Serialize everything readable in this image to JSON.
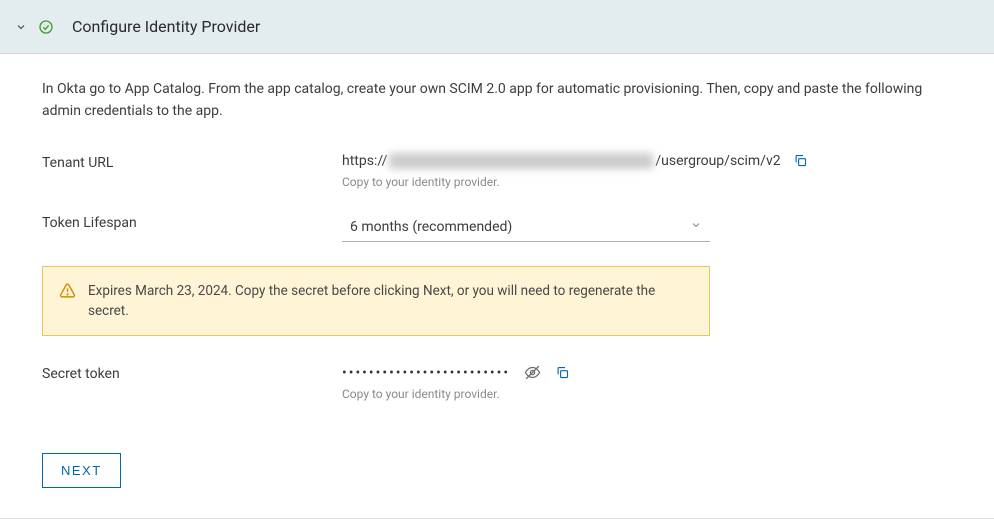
{
  "header": {
    "title": "Configure Identity Provider"
  },
  "intro": "In Okta go to App Catalog. From the app catalog, create your own SCIM 2.0 app for automatic provisioning. Then, copy and paste the following admin credentials to the app.",
  "tenant": {
    "label": "Tenant URL",
    "prefix": "https://",
    "suffix": "/usergroup/scim/v2",
    "helper": "Copy to your identity provider."
  },
  "lifespan": {
    "label": "Token Lifespan",
    "selected": "6 months (recommended)"
  },
  "alert": {
    "text": "Expires March 23, 2024. Copy the secret before clicking Next, or you will need to regenerate the secret."
  },
  "secret": {
    "label": "Secret token",
    "masked": "•••••••••••••••••••••••••",
    "helper": "Copy to your identity provider."
  },
  "actions": {
    "next": "NEXT"
  }
}
